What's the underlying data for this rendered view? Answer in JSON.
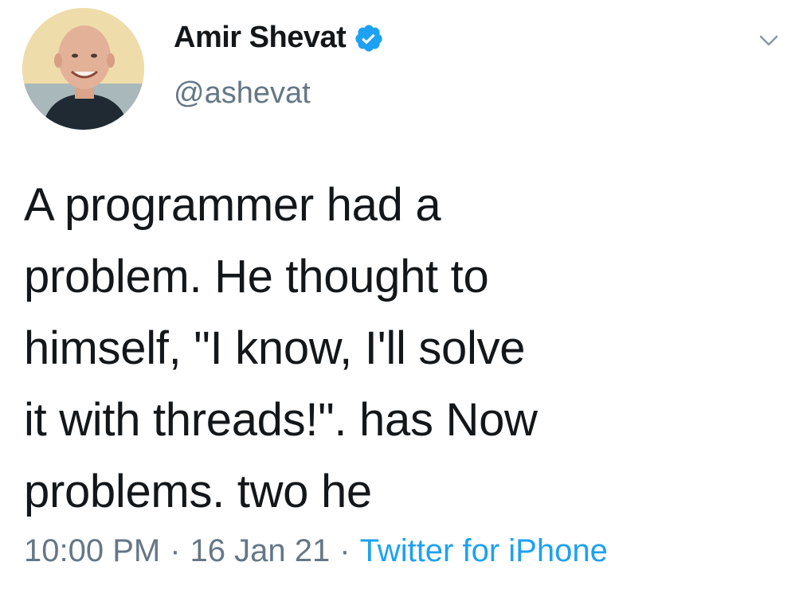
{
  "author": {
    "name": "Amir Shevat",
    "handle": "@ashevat",
    "verified": true
  },
  "tweet": {
    "text": "A programmer had a\nproblem. He thought to\nhimself, \"I know, I'll solve\nit with threads!\". has Now\nproblems. two he"
  },
  "meta": {
    "time": "10:00 PM",
    "separator1": "·",
    "date": "16 Jan 21",
    "separator2": "·",
    "source": "Twitter for iPhone"
  },
  "icons": {
    "verified": "verified-badge-icon",
    "menu": "chevron-down-icon"
  },
  "colors": {
    "text": "#14171a",
    "secondary": "#657786",
    "accent": "#1da1f2"
  }
}
